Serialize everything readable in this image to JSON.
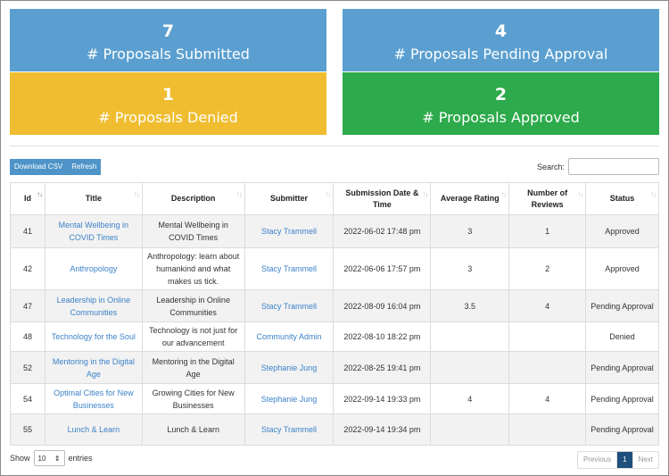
{
  "cards": [
    {
      "count": "7",
      "label": "# Proposals Submitted",
      "color": "#5a9fd0"
    },
    {
      "count": "4",
      "label": "# Proposals Pending Approval",
      "color": "#5a9fd0"
    },
    {
      "count": "1",
      "label": "# Proposals Denied",
      "color": "#f0bd30"
    },
    {
      "count": "2",
      "label": "# Proposals Approved",
      "color": "#2daa4b"
    }
  ],
  "toolbar": {
    "download_label": "Download CSV",
    "refresh_label": "Refresh"
  },
  "search": {
    "label": "Search:",
    "value": ""
  },
  "table": {
    "headers": [
      "Id",
      "Title",
      "Description",
      "Submitter",
      "Submission Date & Time",
      "Average Rating",
      "Number of Reviews",
      "Status"
    ],
    "rows": [
      {
        "id": "41",
        "title": "Mental Wellbeing in COVID Times",
        "description": "Mental Wellbeing in COVID Times",
        "submitter": "Stacy Trammell",
        "date": "2022-06-02 17:48 pm",
        "rating": "3",
        "reviews": "1",
        "status": "Approved"
      },
      {
        "id": "42",
        "title": "Anthropology",
        "description": "Anthropology: learn about humankind and what makes us tick.",
        "submitter": "Stacy Trammell",
        "date": "2022-06-06 17:57 pm",
        "rating": "3",
        "reviews": "2",
        "status": "Approved"
      },
      {
        "id": "47",
        "title": "Leadership in Online Communities",
        "description": "Leadership in Online Communities",
        "submitter": "Stacy Trammell",
        "date": "2022-08-09 16:04 pm",
        "rating": "3.5",
        "reviews": "4",
        "status": "Pending Approval"
      },
      {
        "id": "48",
        "title": "Technology for the Soul",
        "description": "Technology is not just for our advancement",
        "submitter": "Community Admin",
        "date": "2022-08-10 18:22 pm",
        "rating": "",
        "reviews": "",
        "status": "Denied"
      },
      {
        "id": "52",
        "title": "Mentoring in the Digital Age",
        "description": "Mentoring in the Digital Age",
        "submitter": "Stephanie Jung",
        "date": "2022-08-25 19:41 pm",
        "rating": "",
        "reviews": "",
        "status": "Pending Approval"
      },
      {
        "id": "54",
        "title": "Optimal Cities for New Businesses",
        "description": "Growing Cities for New Businesses",
        "submitter": "Stephanie Jung",
        "date": "2022-09-14 19:33 pm",
        "rating": "4",
        "reviews": "4",
        "status": "Pending Approval"
      },
      {
        "id": "55",
        "title": "Lunch & Learn",
        "description": "Lunch & Learn",
        "submitter": "Stacy Trammell",
        "date": "2022-09-14 19:34 pm",
        "rating": "",
        "reviews": "",
        "status": "Pending Approval"
      }
    ]
  },
  "length": {
    "show_label": "Show",
    "value": "10",
    "entries_label": "entries"
  },
  "pagination": {
    "previous": "Previous",
    "current": "1",
    "next": "Next"
  }
}
